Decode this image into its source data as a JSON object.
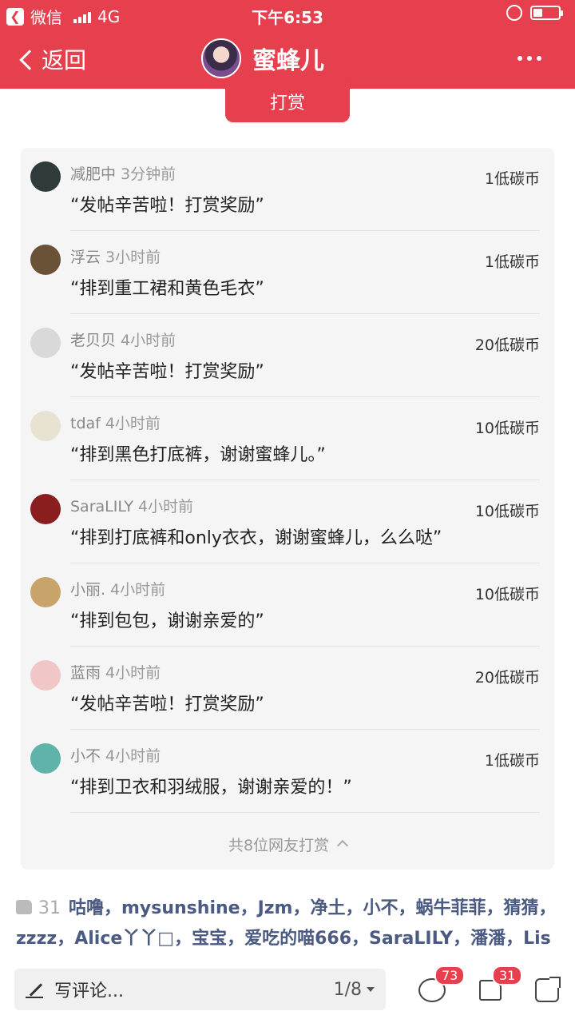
{
  "status_bar": {
    "carrier_app": "微信",
    "network": "4G",
    "time": "下午6:53",
    "battery_level": 0.35
  },
  "nav": {
    "back_label": "返回",
    "title": "蜜蜂儿"
  },
  "reward_button": {
    "label": "打赏"
  },
  "rewards": [
    {
      "name": "减肥中",
      "time": "3分钟前",
      "amount": "1低碳币",
      "message": "“发帖辛苦啦！打赏奖励”",
      "avatar_color": "#2f3a3a"
    },
    {
      "name": "浮云",
      "time": "3小时前",
      "amount": "1低碳币",
      "message": "“排到重工裙和黄色毛衣”",
      "avatar_color": "#6a5236"
    },
    {
      "name": "老贝贝",
      "time": "4小时前",
      "amount": "20低碳币",
      "message": "“发帖辛苦啦！打赏奖励”",
      "avatar_color": "#d9d9d9"
    },
    {
      "name": "tdaf",
      "time": "4小时前",
      "amount": "10低碳币",
      "message": "“排到黑色打底裤，谢谢蜜蜂儿。”",
      "avatar_color": "#e8e2d2"
    },
    {
      "name": "SaraLILY",
      "time": "4小时前",
      "amount": "10低碳币",
      "message": "“排到打底裤和only衣衣，谢谢蜜蜂儿，么么哒”",
      "avatar_color": "#8a1d1d"
    },
    {
      "name": "小丽.",
      "time": "4小时前",
      "amount": "10低碳币",
      "message": "“排到包包，谢谢亲爱的”",
      "avatar_color": "#c9a46a"
    },
    {
      "name": "蓝雨",
      "time": "4小时前",
      "amount": "20低碳币",
      "message": "“发帖辛苦啦！打赏奖励”",
      "avatar_color": "#f0c6c6"
    },
    {
      "name": "小不",
      "time": "4小时前",
      "amount": "1低碳币",
      "message": "“排到卫衣和羽绒服，谢谢亲爱的！”",
      "avatar_color": "#5fb3a8"
    }
  ],
  "rewards_summary": "共8位网友打赏",
  "likes": {
    "count": "31",
    "names": "咕噜，mysunshine，Jzm，净土，小不，蜗牛菲菲，猜猜，zzzz，Alice丫丫□，宝宝，爱吃的喵666，SaraLILY，潘潘，Lis"
  },
  "bottom_bar": {
    "comment_placeholder": "写评论...",
    "page_indicator": "1/8",
    "comments_badge": "73",
    "likes_badge": "31"
  },
  "icons": [
    "chevron-left-icon",
    "more-icon",
    "pen-icon",
    "comment-icon",
    "thumb-up-icon",
    "share-icon"
  ],
  "colors": {
    "brand_red": "#e6404f",
    "link_blue": "#4a5a82"
  }
}
